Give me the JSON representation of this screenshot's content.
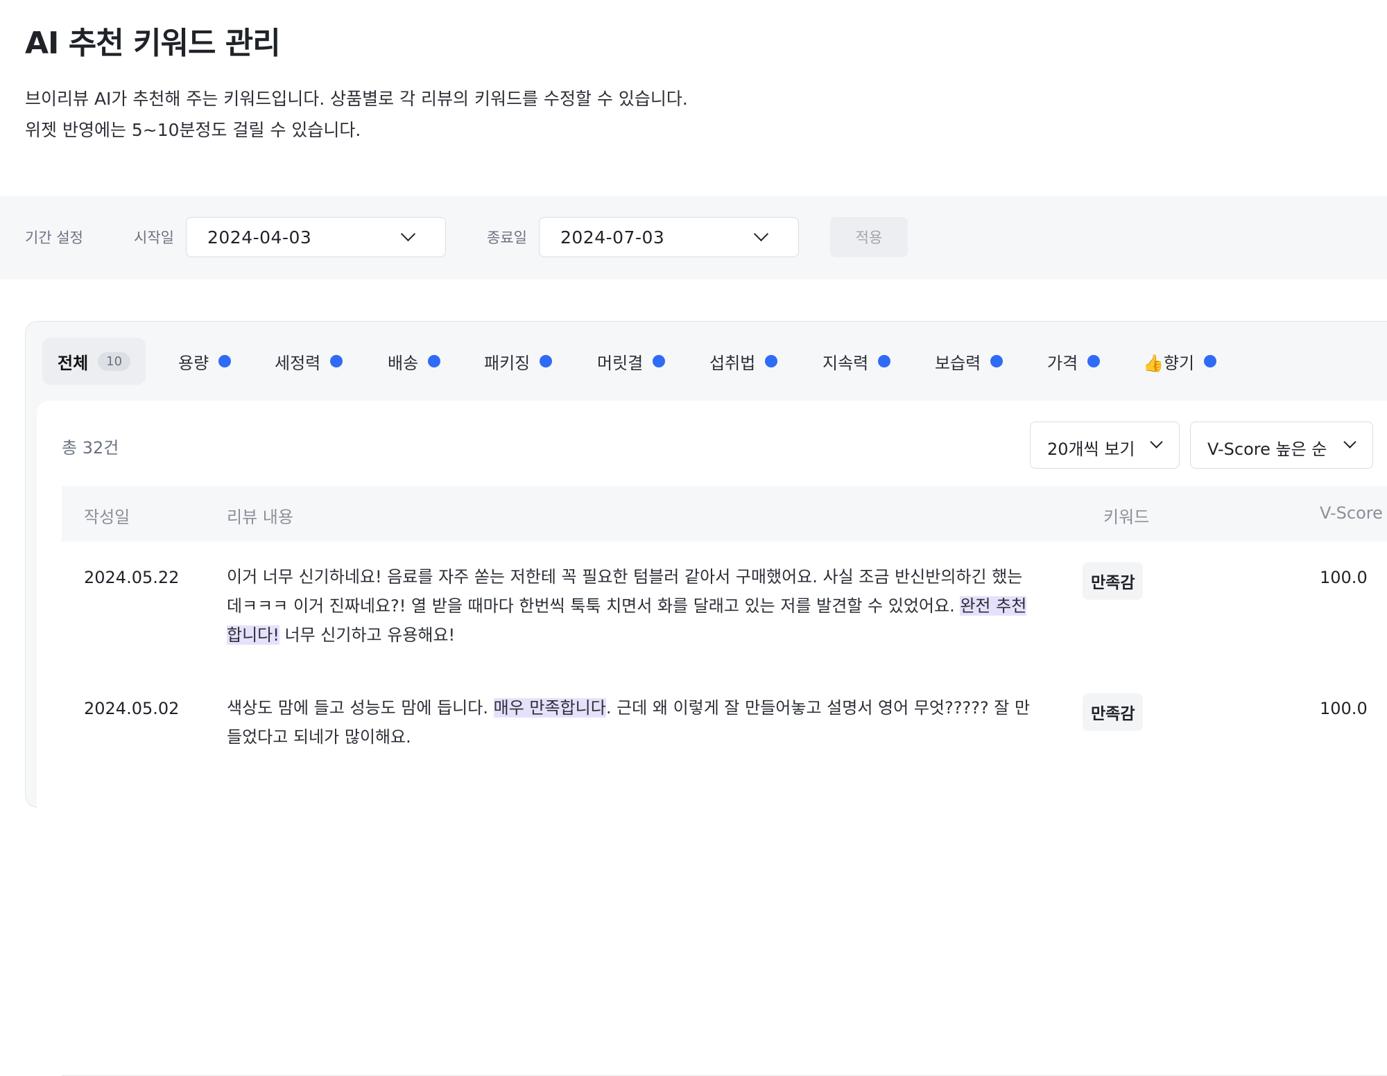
{
  "header": {
    "title": "AI 추천 키워드 관리",
    "desc_line1": "브이리뷰 AI가 추천해 주는 키워드입니다. 상품별로 각 리뷰의 키워드를 수정할 수 있습니다.",
    "desc_line2": "위젯 반영에는 5~10분정도 걸릴 수 있습니다."
  },
  "filter": {
    "period_label": "기간 설정",
    "start_label": "시작일",
    "start_value": "2024-04-03",
    "end_label": "종료일",
    "end_value": "2024-07-03",
    "apply_label": "적용"
  },
  "tabs": [
    {
      "label": "전체",
      "count": "10"
    },
    {
      "label": "용량"
    },
    {
      "label": "세정력"
    },
    {
      "label": "배송"
    },
    {
      "label": "패키징"
    },
    {
      "label": "머릿결"
    },
    {
      "label": "섭취법"
    },
    {
      "label": "지속력"
    },
    {
      "label": "보습력"
    },
    {
      "label": "가격"
    },
    {
      "label": "👍향기"
    }
  ],
  "list": {
    "total": "총 32건",
    "page_size": "20개씩 보기",
    "sort": "V-Score 높은 순",
    "columns": {
      "date": "작성일",
      "content": "리뷰 내용",
      "keyword": "키워드",
      "score": "V-Score"
    },
    "rows": [
      {
        "date": "2024.05.22",
        "text_before": "이거 너무 신기하네요! 음료를 자주 쏟는 저한테 꼭 필요한 텀블러 같아서 구매했어요. 사실 조금 반신반의하긴 했는데ㅋㅋㅋ 이거 진짜네요?! 열 받을 때마다 한번씩 툭툭 치면서 화를 달래고 있는 저를 발견할 수 있었어요. ",
        "highlight": "완전 추천합니다!",
        "text_after": " 너무 신기하고 유용해요!",
        "keyword": "만족감",
        "score": "100.0"
      },
      {
        "date": "2024.05.02",
        "text_before": "색상도 맘에 들고 성능도 맘에 듭니다. ",
        "highlight": "매우 만족합니다",
        "text_after": ". 근데 왜 이렇게 잘 만들어놓고 설명서 영어 무엇????? 잘 만들었다고 되네가 많이해요.",
        "keyword": "만족감",
        "score": "100.0"
      }
    ]
  }
}
